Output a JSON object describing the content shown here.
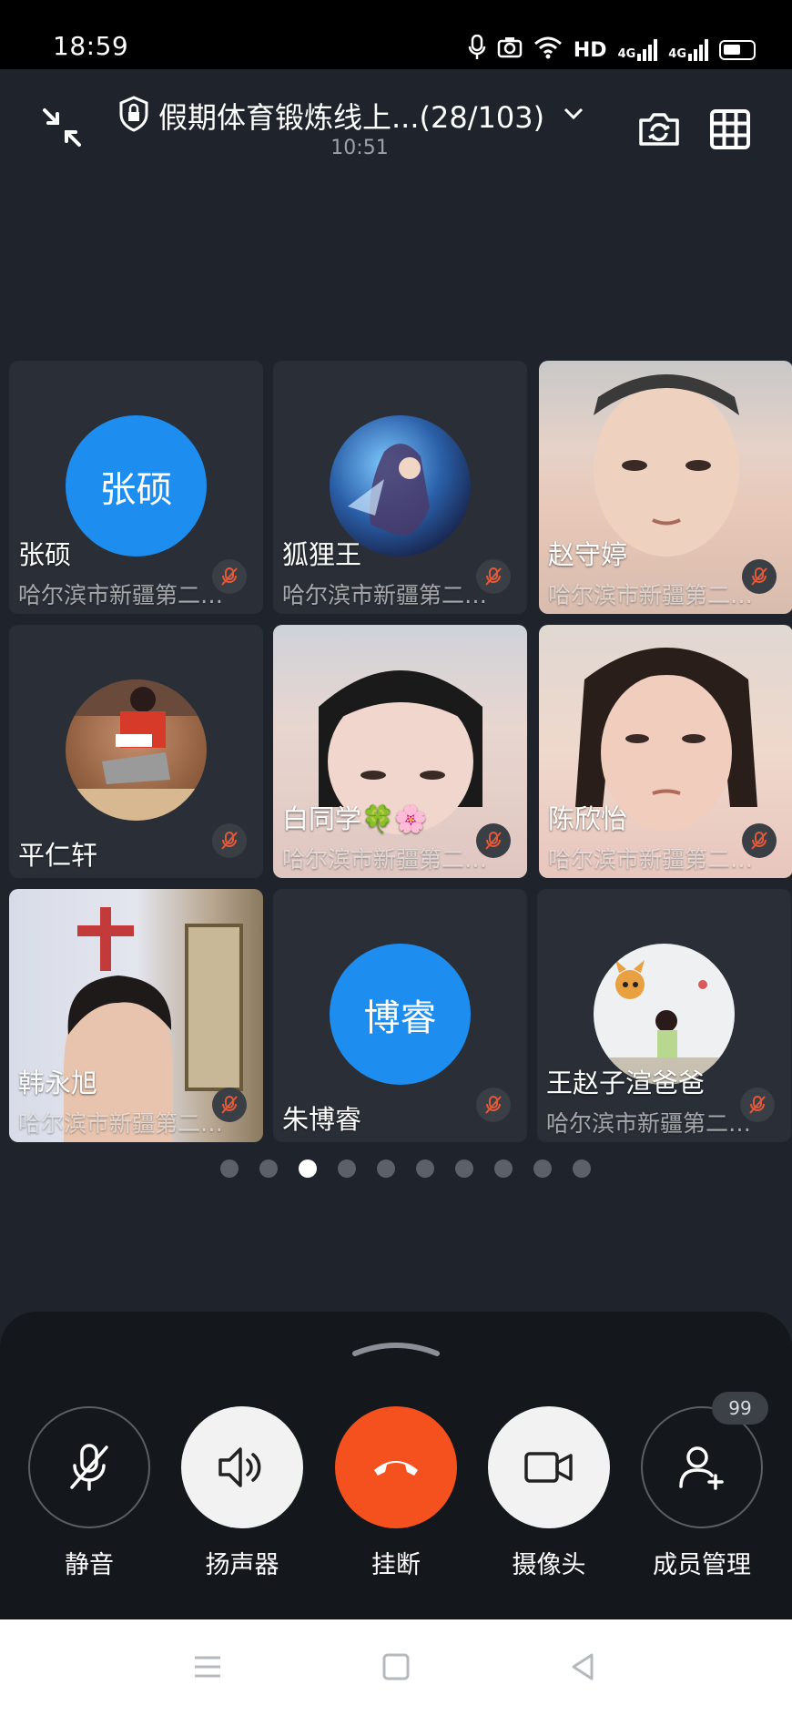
{
  "status_bar": {
    "time": "18:59",
    "network_label": "HD",
    "signal_1": "4G",
    "signal_2": "4G"
  },
  "header": {
    "title": "假期体育锻炼线上...(28/103)",
    "duration": "10:51",
    "icons": [
      "minimize-icon",
      "lock-shield-icon",
      "chevron-down-icon",
      "switch-camera-icon",
      "grid-view-icon"
    ]
  },
  "participants": [
    {
      "avatar_text": "张硕",
      "name": "张硕",
      "org": "哈尔滨市新疆第二…",
      "muted": true,
      "type": "text-avatar"
    },
    {
      "name": "狐狸王",
      "org": "哈尔滨市新疆第二…",
      "muted": true,
      "type": "photo-avatar"
    },
    {
      "name": "赵守婷",
      "org": "哈尔滨市新疆第二…",
      "muted": true,
      "type": "video"
    },
    {
      "name": "平仁轩",
      "muted": true,
      "type": "photo-avatar"
    },
    {
      "name": "白同学🍀🌸",
      "org": "哈尔滨市新疆第二…",
      "muted": true,
      "type": "video"
    },
    {
      "name": "陈欣怡",
      "org": "哈尔滨市新疆第二…",
      "muted": true,
      "type": "video"
    },
    {
      "name": "韩永旭",
      "org": "哈尔滨市新疆第二…",
      "muted": true,
      "type": "video"
    },
    {
      "avatar_text": "博睿",
      "name": "朱博睿",
      "muted": true,
      "type": "text-avatar"
    },
    {
      "name": "王赵子渲爸爸",
      "org": "哈尔滨市新疆第二…",
      "muted": true,
      "type": "photo-avatar"
    }
  ],
  "pagination": {
    "total": 10,
    "active_index": 2
  },
  "controls": {
    "mute": "静音",
    "speaker": "扬声器",
    "hangup": "挂断",
    "camera": "摄像头",
    "members": "成员管理",
    "members_badge": "99"
  },
  "colors": {
    "accent": "#1e8df0",
    "hangup": "#f4511e",
    "background": "#1f242c"
  }
}
